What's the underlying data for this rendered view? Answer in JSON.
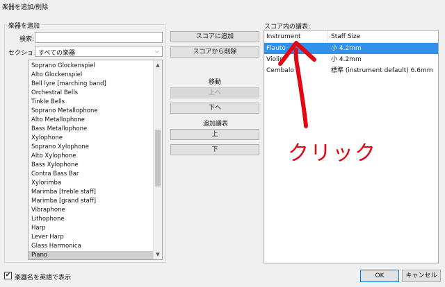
{
  "window": {
    "title": "楽器を追加/削除"
  },
  "add_panel": {
    "title": "楽器を追加",
    "search_label": "検索:",
    "search_value": "",
    "section_label": "セクション:",
    "section_value": "すべての楽器",
    "instruments": [
      "Soprano Glockenspiel",
      "Alto Glockenspiel",
      "Bell lyre [marching band]",
      "Orchestral Bells",
      "Tinkle Bells",
      "Soprano Metallophone",
      "Alto Metallophone",
      "Bass Metallophone",
      "Xylophone",
      "Soprano Xylophone",
      "Alto Xylophone",
      "Bass Xylophone",
      "Contra Bass Bar",
      "Xylorimba",
      "Marimba [treble staff]",
      "Marimba [grand staff]",
      "Vibraphone",
      "Lithophone",
      "Harp",
      "Lever Harp",
      "Glass Harmonica",
      "Piano"
    ],
    "selected_instrument": "Piano"
  },
  "middle": {
    "add_to_score": "スコアに追加",
    "remove_from_score": "スコアから削除",
    "move_heading": "移動",
    "move_up": "上へ",
    "move_down": "下へ",
    "extra_staff_heading": "追加譜表",
    "extra_up": "上",
    "extra_down": "下"
  },
  "score_panel": {
    "title": "スコア内の譜表:",
    "columns": [
      "Instrument",
      "Staff Size"
    ],
    "rows": [
      {
        "instrument": "Flauto",
        "size": "小 4.2mm",
        "selected": true
      },
      {
        "instrument": "Violin",
        "size": "小 4.2mm",
        "selected": false
      },
      {
        "instrument": "Cembalo",
        "size": "標準 (instrument default) 6.6mm",
        "selected": false
      }
    ]
  },
  "annotation": {
    "text": "クリック",
    "color": "#e30613"
  },
  "footer": {
    "checkbox_label": "楽器名を英語で表示",
    "checkbox_checked": true,
    "ok": "OK",
    "cancel": "キャンセル"
  }
}
